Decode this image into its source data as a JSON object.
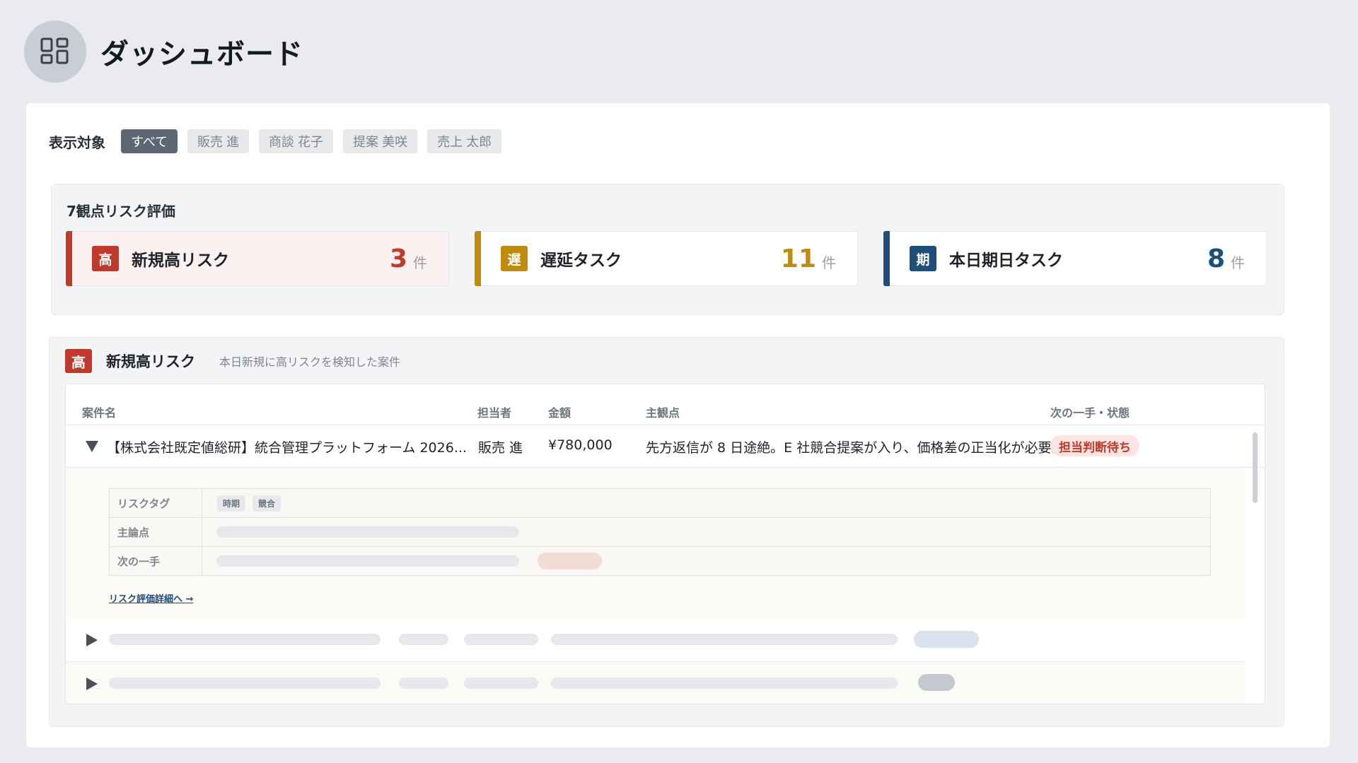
{
  "header": {
    "icon": "dashboard-grid-icon",
    "title": "ダッシュボード"
  },
  "filter": {
    "label": "表示対象",
    "chips": [
      {
        "label": "すべて",
        "active": true
      },
      {
        "label": "販売 進",
        "active": false
      },
      {
        "label": "商談 花子",
        "active": false
      },
      {
        "label": "提案 美咲",
        "active": false
      },
      {
        "label": "売上 太郎",
        "active": false
      }
    ]
  },
  "risk_eval": {
    "title": "7観点リスク評価",
    "cards": [
      {
        "badge": "高",
        "label": "新規高リスク",
        "count": "3",
        "unit": "件",
        "color": "#c0392b"
      },
      {
        "badge": "遅",
        "label": "遅延タスク",
        "count": "11",
        "unit": "件",
        "color": "#c18a0c"
      },
      {
        "badge": "期",
        "label": "本日期日タスク",
        "count": "8",
        "unit": "件",
        "color": "#1f4e79"
      }
    ]
  },
  "high_risk": {
    "badge": "高",
    "title": "新規高リスク",
    "subtitle": "本日新規に高リスクを検知した案件",
    "columns": [
      "案件名",
      "担当者",
      "金額",
      "主観点",
      "次の一手・状態"
    ],
    "rows": [
      {
        "name": "【株式会社既定値総研】統合管理プラットフォーム 2026...",
        "owner": "販売 進",
        "amount": "¥780,000",
        "point": "先方返信が 8 日途絶。E 社競合提案が入り、価格差の正当化が必要。",
        "status": "担当判断待ち",
        "expanded": true,
        "detail": {
          "tag_label": "リスクタグ",
          "tags": [
            "時期",
            "競合"
          ],
          "main_point_label": "主論点",
          "next_step_label": "次の一手",
          "link": "リスク評価詳細へ →"
        }
      }
    ]
  },
  "colors": {
    "high": "#c0392b",
    "delay": "#c18a0c",
    "due": "#1f4e79"
  }
}
